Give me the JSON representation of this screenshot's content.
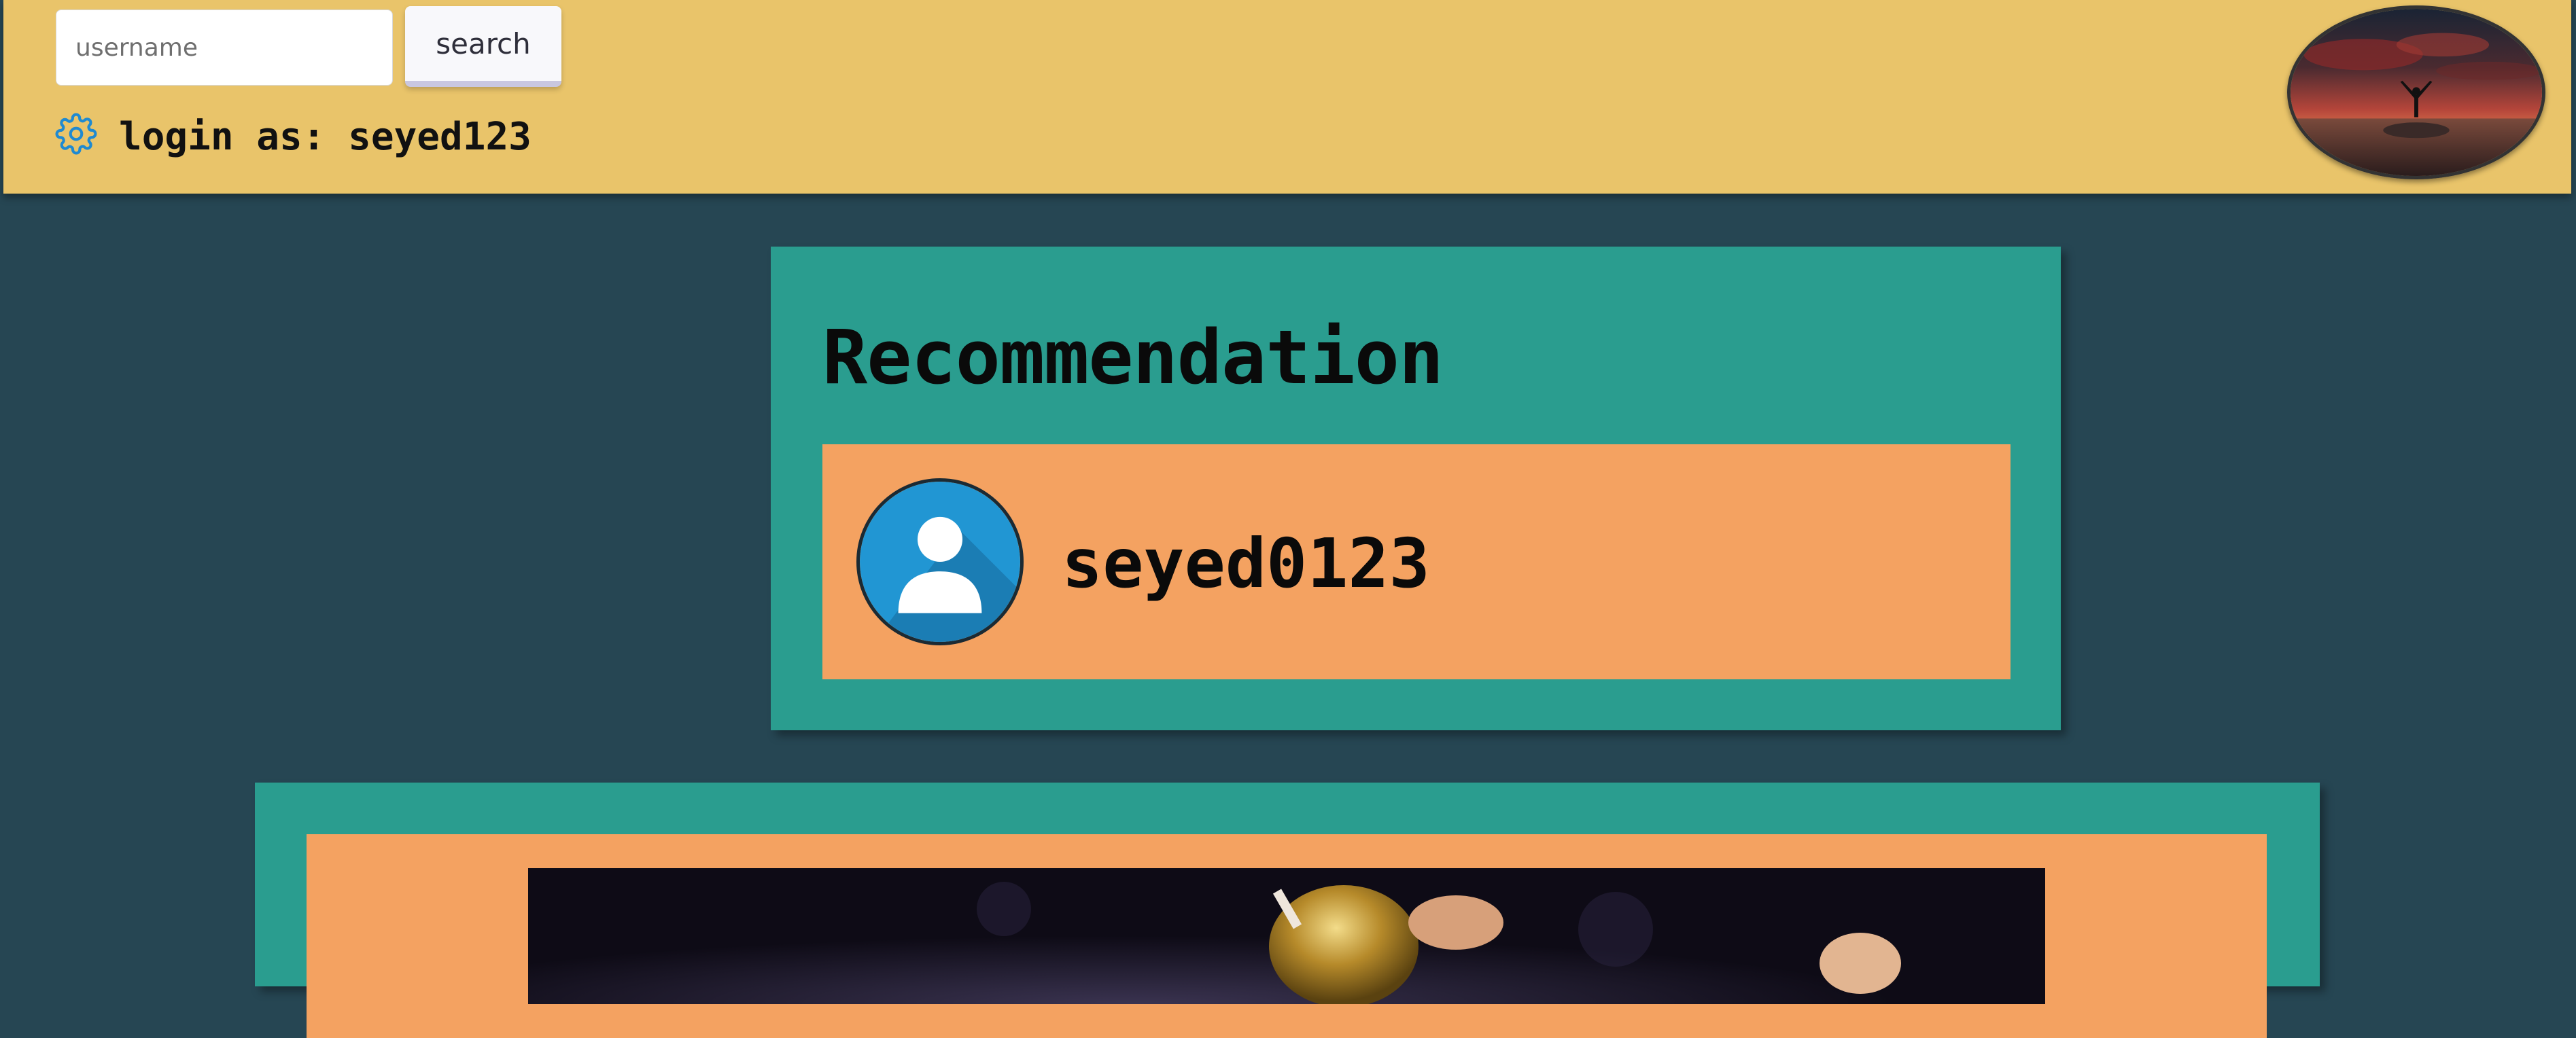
{
  "header": {
    "search": {
      "placeholder": "username",
      "button_label": "search"
    },
    "login_label": "login as: seyed123",
    "icons": [
      "gear-icon",
      "profile-image"
    ]
  },
  "recommendation": {
    "title": "Recommendation",
    "items": [
      {
        "username": "seyed0123",
        "icon": "user-avatar-icon"
      }
    ]
  },
  "colors": {
    "background": "#264653",
    "header": "#e9c46a",
    "card": "#2a9d8f",
    "item": "#f4a261",
    "accent_blue": "#1f8ad1"
  }
}
